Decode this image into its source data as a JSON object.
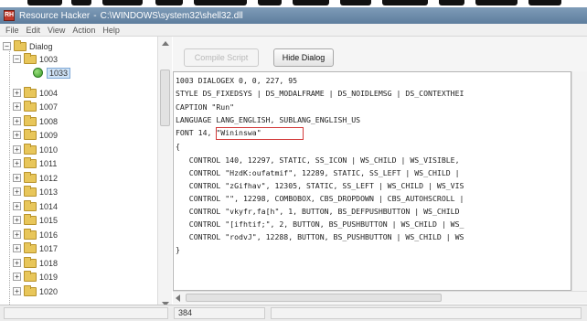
{
  "window": {
    "app_title": "Resource Hacker",
    "separator": "-",
    "file_path": "C:\\WINDOWS\\system32\\shell32.dll"
  },
  "menu": [
    "File",
    "Edit",
    "View",
    "Action",
    "Help"
  ],
  "tree": {
    "root": "Dialog",
    "expanded": "1003",
    "selected": "1033",
    "items": [
      "1004",
      "1007",
      "1008",
      "1009",
      "1010",
      "1011",
      "1012",
      "1013",
      "1014",
      "1015",
      "1016",
      "1017",
      "1018",
      "1019",
      "1020"
    ]
  },
  "toolbar": {
    "compile_label": "Compile Script",
    "hide_dialog_label": "Hide Dialog"
  },
  "script": {
    "lines": [
      "1003 DIALOGEX 0, 0, 227, 95",
      "STYLE DS_FIXEDSYS | DS_MODALFRAME | DS_NOIDLEMSG | DS_CONTEXTHEI",
      "CAPTION \"Run\"",
      "LANGUAGE LANG_ENGLISH, SUBLANG_ENGLISH_US",
      "FONT 14, \"Wininswa\"",
      "{",
      "   CONTROL 140, 12297, STATIC, SS_ICON | WS_CHILD | WS_VISIBLE,",
      "   CONTROL \"HzdK:oufatmif\", 12289, STATIC, SS_LEFT | WS_CHILD |",
      "   CONTROL \"zGifhav\", 12305, STATIC, SS_LEFT | WS_CHILD | WS_VIS",
      "   CONTROL \"\", 12298, COMBOBOX, CBS_DROPDOWN | CBS_AUTOHSCROLL |",
      "   CONTROL \"vkyfr,fa[h\", 1, BUTTON, BS_DEFPUSHBUTTON | WS_CHILD",
      "   CONTROL \"[ifhtif;\", 2, BUTTON, BS_PUSHBUTTON | WS_CHILD | WS_",
      "   CONTROL \"rodvJ\", 12288, BUTTON, BS_PUSHBUTTON | WS_CHILD | WS",
      "}"
    ]
  },
  "status": {
    "position": "384"
  }
}
